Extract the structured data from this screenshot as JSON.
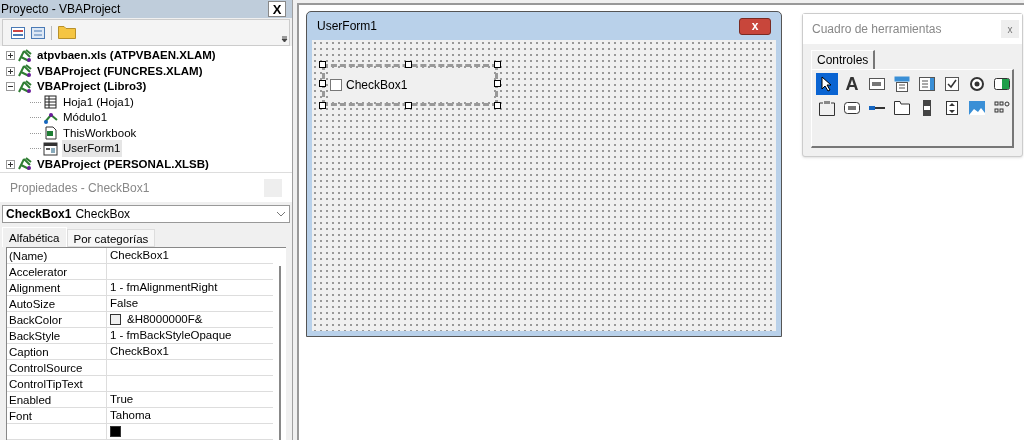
{
  "project_panel": {
    "title": "Proyecto - VBAProject",
    "close": "X",
    "tree": [
      {
        "label": "atpvbaen.xls (ATPVBAEN.XLAM)",
        "kind": "project",
        "expanded": false,
        "selected": false
      },
      {
        "label": "VBAProject (FUNCRES.XLAM)",
        "kind": "project",
        "expanded": false,
        "selected": false
      },
      {
        "label": "VBAProject (Libro3)",
        "kind": "project",
        "expanded": true,
        "selected": false,
        "children": [
          {
            "label": "Hoja1 (Hoja1)",
            "kind": "sheet",
            "selected": false
          },
          {
            "label": "Módulo1",
            "kind": "module",
            "selected": false
          },
          {
            "label": "ThisWorkbook",
            "kind": "workbook",
            "selected": false
          },
          {
            "label": "UserForm1",
            "kind": "form",
            "selected": true
          }
        ]
      },
      {
        "label": "VBAProject (PERSONAL.XLSB)",
        "kind": "project",
        "expanded": false,
        "selected": false
      }
    ]
  },
  "properties_panel": {
    "title": "Propiedades - CheckBox1",
    "object_name": "CheckBox1",
    "object_type": "CheckBox",
    "tabs": [
      {
        "label": "Alfabética",
        "selected": true
      },
      {
        "label": "Por categorías",
        "selected": false
      }
    ],
    "rows": [
      {
        "name": "(Name)",
        "value": "CheckBox1"
      },
      {
        "name": "Accelerator"
      },
      {
        "name": "Alignment",
        "value": "1 - fmAlignmentRight"
      },
      {
        "name": "AutoSize",
        "value": "False"
      },
      {
        "name": "BackColor",
        "value": "&H8000000F&",
        "color": "#f0f0f0"
      },
      {
        "name": "BackStyle",
        "value": "1 - fmBackStyleOpaque"
      },
      {
        "name": "Caption",
        "value": "CheckBox1"
      },
      {
        "name": "ControlSource"
      },
      {
        "name": "ControlTipText"
      },
      {
        "name": "Enabled",
        "value": "True"
      },
      {
        "name": "Font",
        "value": "Tahoma"
      },
      {
        "color": "#000000"
      }
    ]
  },
  "userform": {
    "title": "UserForm1",
    "close": "x",
    "checkbox": {
      "label": "CheckBox1",
      "checked": false
    }
  },
  "toolbox": {
    "title": "Cuadro de herramientas",
    "close": "x",
    "tabs": [
      {
        "label": "Controles",
        "selected": true
      }
    ],
    "tools": [
      {
        "kind": "pointer",
        "selected": true
      },
      {
        "kind": "label",
        "glyph": "A",
        "selected": false
      },
      {
        "kind": "textbox",
        "selected": false
      },
      {
        "kind": "combobox",
        "selected": false
      },
      {
        "kind": "listbox",
        "selected": false
      },
      {
        "kind": "checkbox",
        "selected": false
      },
      {
        "kind": "option",
        "selected": false
      },
      {
        "kind": "toggle",
        "selected": false
      },
      {
        "kind": "frame",
        "selected": false
      },
      {
        "kind": "command",
        "selected": false
      },
      {
        "kind": "tabstrip",
        "selected": false
      },
      {
        "kind": "multipage",
        "selected": false
      },
      {
        "kind": "scrollbar",
        "selected": false
      },
      {
        "kind": "spin",
        "selected": false
      },
      {
        "kind": "image",
        "selected": false
      },
      {
        "kind": "refedit",
        "selected": false
      }
    ]
  }
}
